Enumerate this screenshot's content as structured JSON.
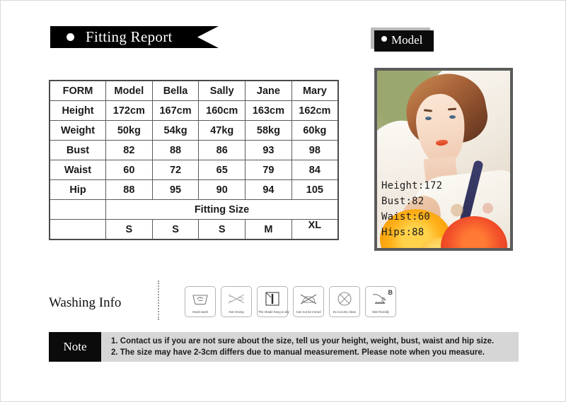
{
  "banner": {
    "title": "Fitting Report",
    "dot_icon": "bullet-dot-icon"
  },
  "model_badge": {
    "label": "Model",
    "dot_icon": "bullet-dot-icon"
  },
  "table": {
    "columns": [
      "FORM",
      "Model",
      "Bella",
      "Sally",
      "Jane",
      "Mary"
    ],
    "rows": [
      {
        "label": "Height",
        "values": [
          "172cm",
          "167cm",
          "160cm",
          "163cm",
          "162cm"
        ]
      },
      {
        "label": "Weight",
        "values": [
          "50kg",
          "54kg",
          "47kg",
          "58kg",
          "60kg"
        ]
      },
      {
        "label": "Bust",
        "values": [
          "82",
          "88",
          "86",
          "93",
          "98"
        ]
      },
      {
        "label": "Waist",
        "values": [
          "60",
          "72",
          "65",
          "79",
          "84"
        ]
      },
      {
        "label": "Hip",
        "values": [
          "88",
          "95",
          "90",
          "94",
          "105"
        ]
      }
    ],
    "fitting_size_label": "Fitting Size",
    "sizes": [
      "S",
      "S",
      "S",
      "M",
      "XL"
    ]
  },
  "photo": {
    "stats": "Height:172\nBust:82\nWaist:60\nHips:88",
    "alt_name": "model-photo"
  },
  "washing": {
    "title": "Washing Info",
    "icons": [
      {
        "name": "hand-wash-icon",
        "label": "Hand wash"
      },
      {
        "name": "no-wringing-icon",
        "label": "Not rinsing"
      },
      {
        "name": "shade-hang-dry-icon",
        "label": "The shade hang to dry"
      },
      {
        "name": "do-not-iron-icon",
        "label": "Can not be ironed"
      },
      {
        "name": "do-not-dry-clean-icon",
        "label": "Do not dry clean"
      },
      {
        "name": "skin-friendly-icon",
        "label": "Skin-friendly",
        "corner": "B"
      }
    ]
  },
  "note": {
    "label": "Note",
    "lines": [
      "1. Contact us if you are not sure about the size, tell us your height, weight, bust, waist and hip size.",
      "2. The size may have 2-3cm differs due to manual measurement. Please note when you measure."
    ]
  },
  "colors": {
    "banner_bg": "#000000",
    "label_cell": "#949494",
    "model_cell": "#c4c4c4",
    "note_body": "#d6d6d6",
    "photo_border": "#5b5b5b"
  }
}
